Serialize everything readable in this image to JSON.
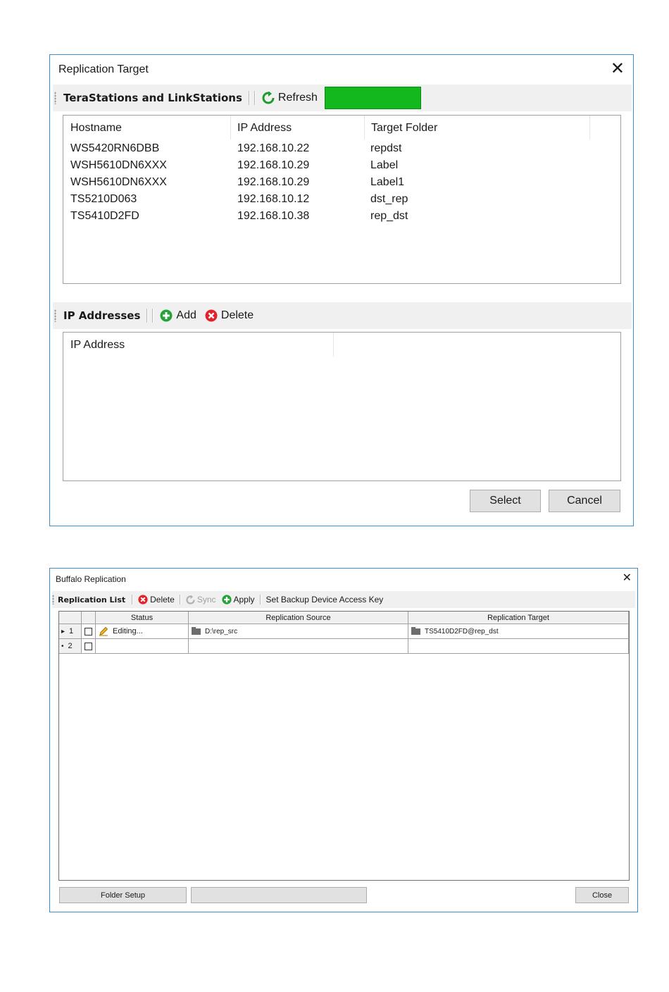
{
  "replication_target": {
    "title": "Replication Target",
    "toolbar1": {
      "label": "TeraStations and LinkStations",
      "refresh_label": "Refresh",
      "progress_color": "#12b81e"
    },
    "columns": [
      "Hostname",
      "IP Address",
      "Target Folder"
    ],
    "rows": [
      {
        "hostname": "WS5420RN6DBB",
        "ip": "192.168.10.22",
        "folder": "repdst"
      },
      {
        "hostname": "WSH5610DN6XXX",
        "ip": "192.168.10.29",
        "folder": "Label"
      },
      {
        "hostname": "WSH5610DN6XXX",
        "ip": "192.168.10.29",
        "folder": "Label1"
      },
      {
        "hostname": "TS5210D063",
        "ip": "192.168.10.12",
        "folder": "dst_rep"
      },
      {
        "hostname": "TS5410D2FD",
        "ip": "192.168.10.38",
        "folder": "rep_dst"
      }
    ],
    "toolbar2": {
      "label": "IP Addresses",
      "add_label": "Add",
      "delete_label": "Delete"
    },
    "ip_column": "IP Address",
    "select_label": "Select",
    "cancel_label": "Cancel",
    "close_glyph": "✕"
  },
  "buffalo_replication": {
    "title": "Buffalo Replication",
    "close_glyph": "✕",
    "toolbar": {
      "label": "Replication List",
      "delete_label": "Delete",
      "sync_label": "Sync",
      "apply_label": "Apply",
      "access_key_label": "Set Backup Device Access Key"
    },
    "columns": [
      "Status",
      "Replication Source",
      "Replication Target"
    ],
    "rows": [
      {
        "marker": "▸",
        "num": "1",
        "status": "Editing...",
        "source": "D:\\rep_src",
        "target": "TS5410D2FD@rep_dst"
      },
      {
        "marker": "•",
        "num": "2",
        "status": "",
        "source": "",
        "target": ""
      }
    ],
    "folder_setup_label": "Folder Setup",
    "close_label": "Close"
  },
  "colors": {
    "window_border": "#3c8dd1",
    "add_green": "#21a336",
    "delete_red": "#e0242e",
    "refresh_green": "#1f9b2f"
  }
}
